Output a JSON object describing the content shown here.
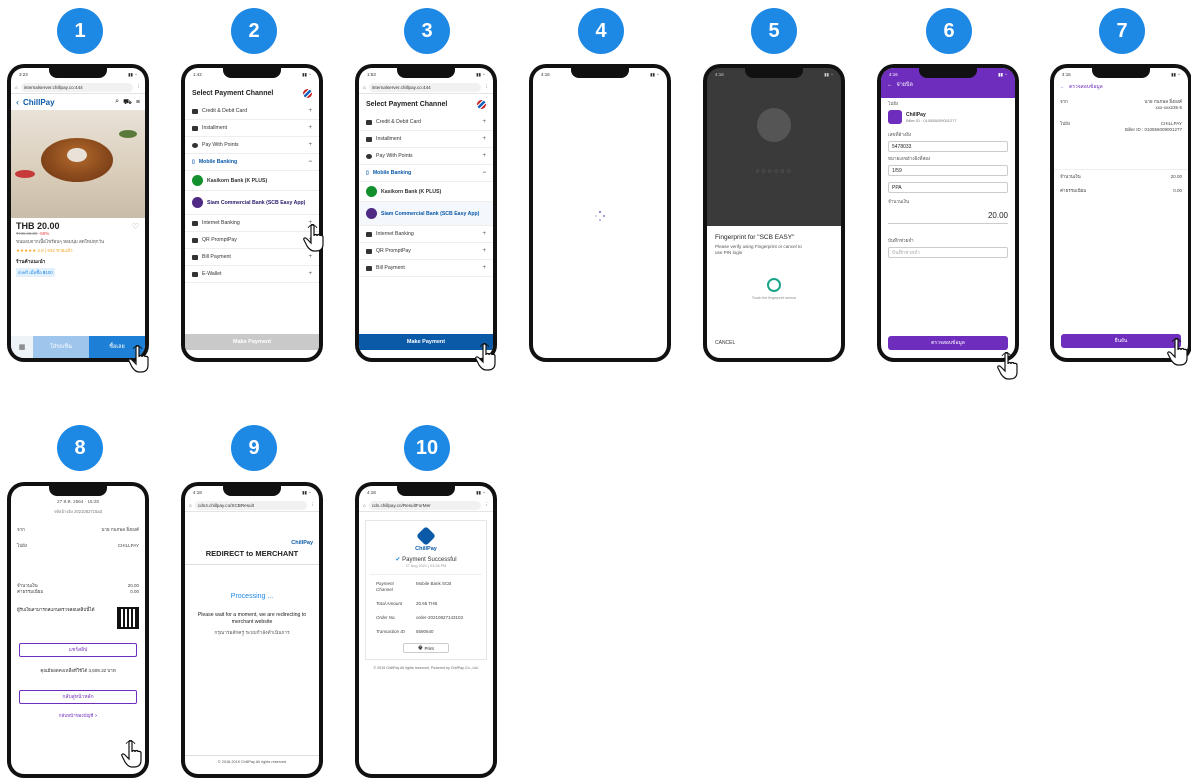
{
  "steps": [
    "1",
    "2",
    "3",
    "4",
    "5",
    "6",
    "7",
    "8",
    "9",
    "10"
  ],
  "colors": {
    "badge": "#1e88e5",
    "scb_purple": "#6f2dbd",
    "kbank_green": "#138f2d",
    "chillpay_blue": "#0b5aa8"
  },
  "phone1": {
    "url": "internalserver.chillpay.co:444",
    "logo": "ChillPay",
    "price": "THB 20.00",
    "old_price": "THB 40.00",
    "discount": "-50%",
    "desc": "ขนมอบจากเนื้อไข่ร้อนๆ หอมนุ่ม สดใหม่ทุกวัน",
    "rating": "★★★★★ 4.8 | 932 ขายแล้ว",
    "shop_label": "ร้านค้าแนะนำ",
    "shop_tag": "ส่งฟรี เมื่อซื้อ ฿100",
    "cart_btn": "ใส่รถเข็น",
    "buy_btn": "ซื้อเลย"
  },
  "channel": {
    "title": "Select Payment Channel",
    "credit": "Credit & Debit Card",
    "installment": "Installment",
    "points": "Pay With Points",
    "mobile": "Mobile Banking",
    "kbank": "Kasikorn Bank (K PLUS)",
    "scb": "Siam Commercial Bank (SCB Easy App)",
    "internet": "Internet Banking",
    "qr": "QR PromptPay",
    "bill": "Bill Payment",
    "ewallet": "E-Wallet",
    "make": "Make Payment",
    "url3": "internalserver.chillpay.co:444"
  },
  "phone5": {
    "title": "Fingerprint for \"SCB EASY\"",
    "sub": "Please verify using Fingerprint or cancel to use PIN login",
    "touch": "Touch the fingerprint sensor",
    "cancel": "CANCEL"
  },
  "phone6": {
    "header": "จ่ายบิล",
    "from": "ไปยัง",
    "biller": "ChillPay",
    "biller_id": "Biller ID : 010556009001277",
    "ref1_label": "เลขที่อ้างอิง",
    "ref1": "5478033",
    "ref2_label": "หมายเลขอ้างอิงที่สอง",
    "ref2": "1/59",
    "ref3": "PPA",
    "amount_label": "จำนวนเงิน",
    "amount": "20.00",
    "note_label": "บันทึกช่วยจำ",
    "note_placeholder": "บันทึกช่วยจำ",
    "btn": "ตรวจสอบข้อมูล"
  },
  "phone7": {
    "header": "ตรวจสอบข้อมูล",
    "from_label": "จาก",
    "from_name": "นาย กนกพล ยิ่งยงค์",
    "from_acc": "xxx-xxx235-5",
    "to_label": "ไปยัง",
    "to_name": "CHILLPAY",
    "to_detail": "Biller ID : 010556009001277",
    "amount_label": "จำนวนเงิน",
    "amount": "20.00",
    "fee_label": "ค่าธรรมเนียม",
    "fee": "0.00",
    "btn": "ยืนยัน"
  },
  "phone8": {
    "date": "27 ส.ค. 2564 · 15:28",
    "ref": "รหัสอ้างอิง 2021082715a3",
    "from_label": "จาก",
    "from_name": "นาย กนกพล ยิ่งยงค์",
    "to_label": "ไปยัง",
    "to_name": "CHILLPAY",
    "amount_label": "จำนวนเงิน",
    "amount": "20.00",
    "fee_label": "ค่าธรรมเนียม",
    "fee": "0.00",
    "qr_text": "ผู้รับเงินสามารถสแกนตรวจสอบสลิปนี้ได้",
    "save_btn": "แชร์สลิป",
    "balance": "คุณมียอดคงเหลือที่ใช้ได้ 3,609.32 บาท",
    "home_btn": "กลับสู่หน้าหลัก",
    "link": "กลับหน้าของบัญชี >"
  },
  "phone9": {
    "url": "cdn4.chillpay.co/SCBResult",
    "logo": "ChillPay",
    "title": "REDIRECT to MERCHANT",
    "processing": "Processing ...",
    "msg": "Please wait for a moment, we are redirecting to merchant website",
    "msg_th": "กรุณารอสักครู่ ระบบกำลังดำเนินการ",
    "footer": "© 2018-2019 ChillPay All rights reserved"
  },
  "phone10": {
    "url": "cdn.chillpay.co/ResultForMer",
    "logo": "ChillPay",
    "status": "Payment Successful",
    "date": "27 Aug 2021 | 03:28 PM",
    "rows": [
      {
        "k": "Payment Channel",
        "v": "Mobile Bank SCB"
      },
      {
        "k": "Total Amount",
        "v": "20.65 THB"
      },
      {
        "k": "Order No.",
        "v": "order-20210827143103"
      },
      {
        "k": "Transaction ID",
        "v": "5590640"
      }
    ],
    "print": "Print",
    "footer": "© 2019 ChillPay All rights reserved. Powered by ChillPay Co., Ltd."
  }
}
